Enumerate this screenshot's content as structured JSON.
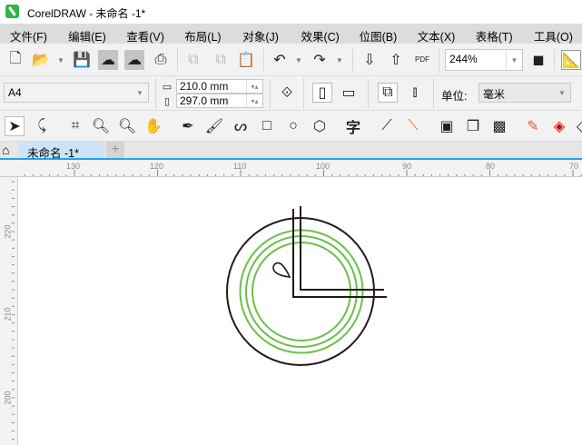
{
  "window": {
    "title": "CorelDRAW - 未命名 -1*"
  },
  "menu": [
    "文件(F)",
    "编辑(E)",
    "查看(V)",
    "布局(L)",
    "对象(J)",
    "效果(C)",
    "位图(B)",
    "文本(X)",
    "表格(T)",
    "工具(O)"
  ],
  "toolbar": {
    "zoom_value": "244%",
    "pdf_label": "PDF"
  },
  "properties": {
    "page_size": "A4",
    "width": "210.0 mm",
    "height": "297.0 mm",
    "units_label": "单位:",
    "units_value": "毫米"
  },
  "document_tab": {
    "label": "未命名 -1*",
    "add_label": "+"
  },
  "ruler": {
    "horizontal": [
      "130",
      "120",
      "110",
      "100",
      "90",
      "80",
      "70"
    ],
    "vertical": [
      "220",
      "210",
      "200"
    ]
  },
  "colors": {
    "accent": "#1aa6e8",
    "green_rings": "#6abf4b",
    "stroke": "#231815"
  }
}
